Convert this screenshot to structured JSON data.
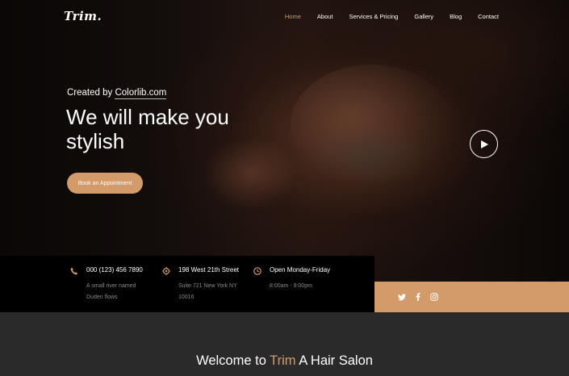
{
  "brand": {
    "logo": "Trim."
  },
  "nav": {
    "items": [
      "Home",
      "About",
      "Services & Pricing",
      "Gallery",
      "Blog",
      "Contact"
    ],
    "active": "Home"
  },
  "hero": {
    "created_prefix": "Created by ",
    "created_link": "Colorlib.com",
    "headline": "We will make you stylish",
    "cta": "Book an Appointment",
    "play_icon": "play-icon"
  },
  "info": {
    "phone": {
      "title": "000 (123) 456 7890",
      "line1": "A small river named",
      "line2": "Duden flows"
    },
    "address": {
      "title": "198 West 21th Street",
      "line1": "Suite 721 New York NY",
      "line2": "10016"
    },
    "hours": {
      "title": "Open Monday-Friday",
      "line1": "8:00am - 9:00pm"
    }
  },
  "social": {
    "icons": [
      "twitter-icon",
      "facebook-icon",
      "instagram-icon"
    ]
  },
  "welcome": {
    "prefix": "Welcome to ",
    "accent": "Trim",
    "suffix": " A Hair Salon"
  },
  "colors": {
    "accent": "#d39b6a",
    "info_bar": "#000000",
    "section_bg": "#2a2a2a"
  }
}
